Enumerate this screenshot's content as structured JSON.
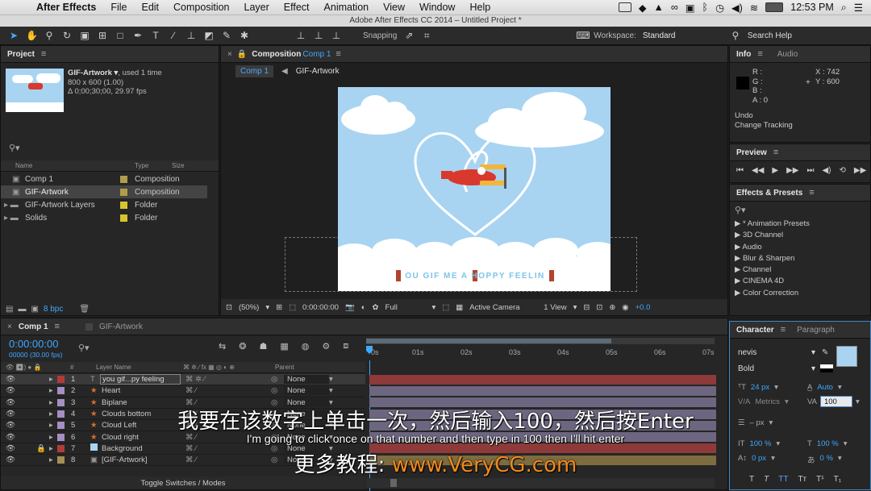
{
  "menubar": {
    "app": "After Effects",
    "items": [
      "File",
      "Edit",
      "Composition",
      "Layer",
      "Effect",
      "Animation",
      "View",
      "Window",
      "Help"
    ],
    "clock": "12:53 PM"
  },
  "window_title": "Adobe After Effects CC 2014 – Untitled Project *",
  "toolbar": {
    "snapping": "Snapping",
    "workspace_label": "Workspace:",
    "workspace_value": "Standard",
    "search_help": "Search Help"
  },
  "project": {
    "tab": "Project",
    "item_name": "GIF-Artwork ▾",
    "item_used": ", used 1 time",
    "item_size": "800 x 600 (1.00)",
    "item_duration": "Δ 0;00;30;00, 29.97 fps",
    "search_icon": "search-icon",
    "col_name": "Name",
    "col_type": "Type",
    "col_size": "Size",
    "rows": [
      {
        "name": "Comp 1",
        "type": "Composition",
        "color": "#b09d4a"
      },
      {
        "name": "GIF-Artwork",
        "type": "Composition",
        "color": "#b09d4a"
      },
      {
        "name": "GIF-Artwork Layers",
        "type": "Folder",
        "color": "#d7c430"
      },
      {
        "name": "Solids",
        "type": "Folder",
        "color": "#d7c430"
      }
    ],
    "bpc": "8 bpc"
  },
  "composition": {
    "tab_label": "Composition",
    "tab_comp": "Comp 1",
    "crumb_active": "Comp 1",
    "crumb_next": "GIF-Artwork",
    "banner_text": "OU GIF ME A HOPPY FEELIN",
    "zoom": "(50%)",
    "timecode": "0:00:00:00",
    "resolution": "Full",
    "camera": "Active Camera",
    "views": "1 View",
    "exposure": "+0.0"
  },
  "info": {
    "tab": "Info",
    "tab2": "Audio",
    "r": "R :",
    "g": "G :",
    "b": "B :",
    "a": "A : 0",
    "x": "X : 742",
    "y": "Y : 600",
    "undo": "Undo",
    "undo_action": "Change Tracking"
  },
  "preview": {
    "tab": "Preview"
  },
  "effects": {
    "tab": "Effects & Presets",
    "items": [
      "* Animation Presets",
      "3D Channel",
      "Audio",
      "Blur & Sharpen",
      "Channel",
      "CINEMA 4D",
      "Color Correction"
    ]
  },
  "character": {
    "tab": "Character",
    "tab2": "Paragraph",
    "font": "nevis",
    "style": "Bold",
    "size": "24 px",
    "leading": "Auto",
    "kerning": "Metrics",
    "tracking": "100",
    "stroke": "– px",
    "vscale": "100 %",
    "hscale": "100 %",
    "baseline": "0 px",
    "tsume": "0 %",
    "fill_color": "#a8d4f2"
  },
  "timeline": {
    "tab": "Comp 1",
    "tab2": "GIF-Artwork",
    "timecode": "0:00:00:00",
    "frames": "00000 (30.00 fps)",
    "col_num": "#",
    "col_layer": "Layer Name",
    "col_parent": "Parent",
    "ruler": [
      "0s",
      "01s",
      "02s",
      "03s",
      "04s",
      "05s",
      "06s",
      "07s"
    ],
    "layers": [
      {
        "num": "1",
        "name": "you gif...py feeling",
        "parent": "None",
        "color": "#b33a3a"
      },
      {
        "num": "2",
        "name": "Heart",
        "parent": "None",
        "color": "#a58fc5"
      },
      {
        "num": "3",
        "name": "Biplane",
        "parent": "None",
        "color": "#a58fc5"
      },
      {
        "num": "4",
        "name": "Clouds bottom",
        "parent": "None",
        "color": "#a58fc5"
      },
      {
        "num": "5",
        "name": "Cloud Left",
        "parent": "None",
        "color": "#a58fc5"
      },
      {
        "num": "6",
        "name": "Cloud right",
        "parent": "None",
        "color": "#a58fc5"
      },
      {
        "num": "7",
        "name": "Background",
        "parent": "None",
        "color": "#b33a3a"
      },
      {
        "num": "8",
        "name": "[GIF-Artwork]",
        "parent": "None",
        "color": "#a58f55"
      }
    ],
    "toggle": "Toggle Switches / Modes"
  },
  "subtitles": {
    "zh": "我要在该数字上单击一次，然后输入100，然后按Enter",
    "en": "I'm going to click once on that number and then type in 100 then I'll hit enter",
    "promo_label": "更多教程:",
    "promo_url": "www.VeryCG.com"
  }
}
